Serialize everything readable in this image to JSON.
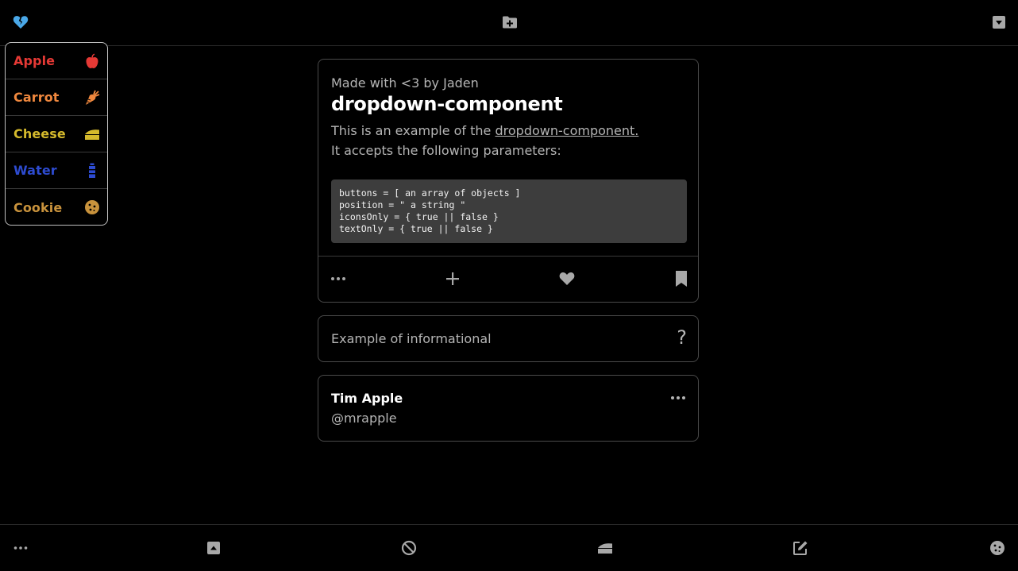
{
  "topbar": {
    "left_icon": "broken-heart-icon",
    "center_icon": "folder-plus-icon",
    "right_icon": "caret-square-down-icon"
  },
  "dropdown": {
    "items": [
      {
        "label": "Apple",
        "icon": "apple-icon",
        "color": "#e53935"
      },
      {
        "label": "Carrot",
        "icon": "carrot-icon",
        "color": "#f0883e"
      },
      {
        "label": "Cheese",
        "icon": "cheese-icon",
        "color": "#d4b92c"
      },
      {
        "label": "Water",
        "icon": "water-bottle-icon",
        "color": "#2d4bd0"
      },
      {
        "label": "Cookie",
        "icon": "cookie-icon",
        "color": "#c8923c"
      }
    ]
  },
  "card": {
    "author": "Made with <3 by Jaden",
    "title": "dropdown-component",
    "desc_prefix": "This is an example of the",
    "desc_link": "dropdown-component.",
    "desc_line2": "It accepts the following parameters:",
    "code_lines": [
      "buttons = [ an array of objects ]",
      "position = \" a string \"",
      "iconsOnly = { true || false }",
      "textOnly = { true || false }"
    ],
    "actions": [
      "more-icon",
      "plus-icon",
      "heart-icon",
      "bookmark-icon"
    ]
  },
  "info": {
    "text": "Example of informational",
    "icon_text": "?"
  },
  "user": {
    "name": "Tim Apple",
    "handle": "@mrapple"
  },
  "bottombar": {
    "icons": [
      "more-icon",
      "caret-square-up-icon",
      "ban-icon",
      "cheese-icon",
      "edit-icon",
      "cookie-icon"
    ]
  },
  "colors": {
    "background": "#000000",
    "accent_heart": "#4aa8e8",
    "muted_text": "#b5b5b5",
    "code_bg": "#3d3d3d"
  }
}
